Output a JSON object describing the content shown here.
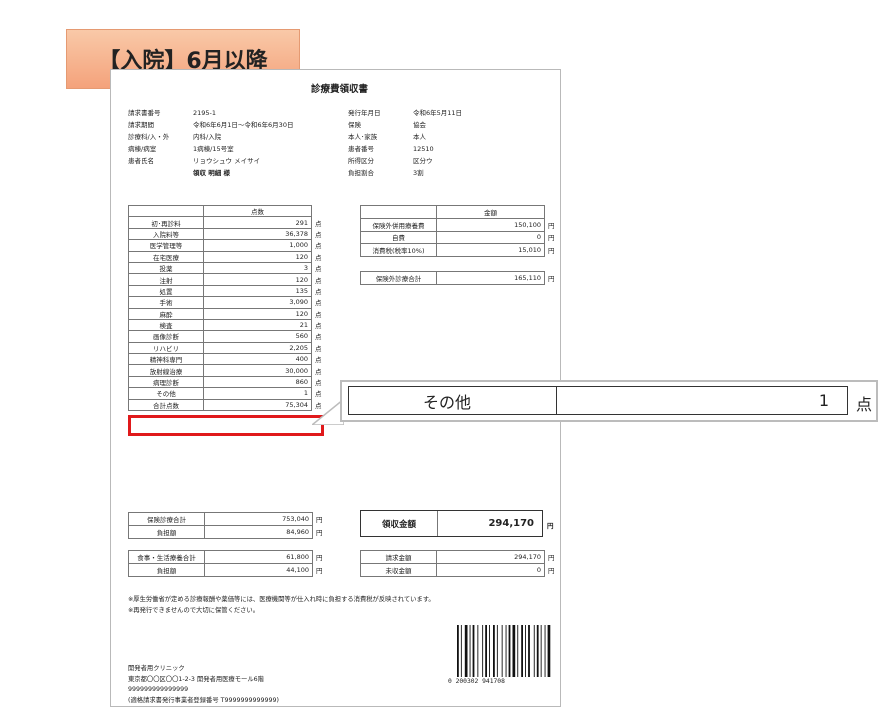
{
  "tag_label": "【入院】6月以降",
  "doc": {
    "title": "診療費領収書",
    "left_info": [
      {
        "k": "請求書番号",
        "v": "2195-1"
      },
      {
        "k": "請求期間",
        "v": "令和6年6月1日～令和6年6月30日"
      },
      {
        "k": "診療科/入・外",
        "v": "内科/入院"
      },
      {
        "k": "病棟/病室",
        "v": "1病棟/15号室"
      },
      {
        "k": "患者氏名",
        "v": "リョウシュウ メイサイ"
      }
    ],
    "patient_sub": "領収 明細 様",
    "right_info": [
      {
        "k": "発行年月日",
        "v": "令和6年5月11日"
      },
      {
        "k": "保険",
        "v": "協会"
      },
      {
        "k": "本人･家族",
        "v": "本人"
      },
      {
        "k": "患者番号",
        "v": "12510"
      },
      {
        "k": "所得区分",
        "v": "区分ウ"
      },
      {
        "k": "負担割合",
        "v": "3割"
      }
    ],
    "points_header": "点数",
    "point_unit": "点",
    "points": [
      {
        "name": "初･再診料",
        "value": "291"
      },
      {
        "name": "入院料等",
        "value": "36,378"
      },
      {
        "name": "医学管理等",
        "value": "1,000"
      },
      {
        "name": "在宅医療",
        "value": "120"
      },
      {
        "name": "投薬",
        "value": "3"
      },
      {
        "name": "注射",
        "value": "120"
      },
      {
        "name": "処置",
        "value": "135"
      },
      {
        "name": "手術",
        "value": "3,090"
      },
      {
        "name": "麻酔",
        "value": "120"
      },
      {
        "name": "検査",
        "value": "21"
      },
      {
        "name": "画像診断",
        "value": "560"
      },
      {
        "name": "リハビリ",
        "value": "2,205"
      },
      {
        "name": "精神科専門",
        "value": "400"
      },
      {
        "name": "放射線治療",
        "value": "30,000"
      },
      {
        "name": "病理診断",
        "value": "860"
      },
      {
        "name": "その他",
        "value": "1"
      },
      {
        "name": "合計点数",
        "value": "75,304"
      }
    ],
    "money_header": "金額",
    "yen_unit": "円",
    "money": [
      {
        "name": "保険外併用療養費",
        "value": "150,100"
      },
      {
        "name": "自費",
        "value": "0"
      },
      {
        "name": "消費税(税率10%)",
        "value": "15,010"
      }
    ],
    "money_total": {
      "name": "保険外診療合計",
      "value": "165,110"
    },
    "insurance": [
      {
        "name": "保険診療合計",
        "value": "753,040"
      },
      {
        "name": "負担額",
        "value": "84,960"
      }
    ],
    "meal": [
      {
        "name": "食事・生活療養合計",
        "value": "61,800"
      },
      {
        "name": "負担額",
        "value": "44,100"
      }
    ],
    "receipt": {
      "label": "領収金額",
      "value": "294,170",
      "unit": "円"
    },
    "billing": [
      {
        "name": "請求金額",
        "value": "294,170"
      },
      {
        "name": "未収金額",
        "value": "0"
      }
    ],
    "notes": [
      "※厚生労働省が定める診療報酬や薬価等には、医療機関等が仕入れ時に負担する消費税が反映されています。",
      "※再発行できませんので大切に保管ください。"
    ],
    "issuer": [
      "開発者用クリニック",
      "東京都〇〇区〇〇1-2-3 開発者用医療モール6階",
      "999999999999999",
      "(適格請求書発行事業者登録番号 T9999999999999)"
    ],
    "barcode_number": "0   200302   941708"
  },
  "zoom": {
    "name": "その他",
    "value": "1",
    "unit": "点"
  }
}
